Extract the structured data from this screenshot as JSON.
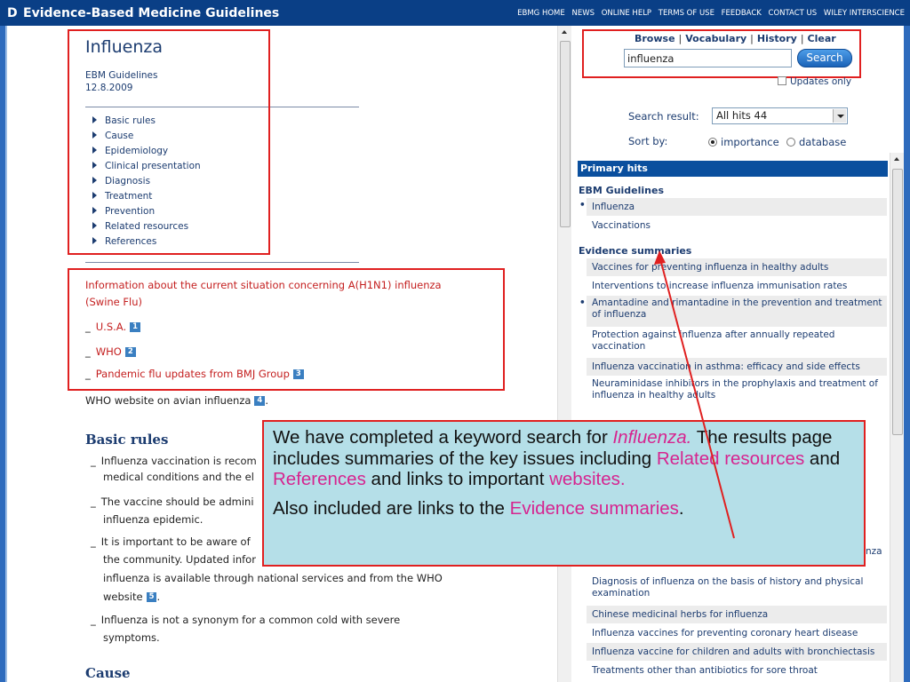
{
  "header": {
    "logo_letter": "D",
    "title": "Evidence-Based Medicine Guidelines",
    "nav": [
      "EBMG HOME",
      "NEWS",
      "ONLINE HELP",
      "TERMS OF USE",
      "FEEDBACK",
      "CONTACT US",
      "WILEY INTERSCIENCE"
    ]
  },
  "article": {
    "title": "Influenza",
    "source": "EBM Guidelines",
    "date": "12.8.2009",
    "toc": [
      "Basic rules",
      "Cause",
      "Epidemiology",
      "Clinical presentation",
      "Diagnosis",
      "Treatment",
      "Prevention",
      "Related resources",
      "References"
    ],
    "h1n1_line1": "Information about the current situation concerning A(H1N1) influenza",
    "h1n1_line2": "(Swine Flu)",
    "links": [
      {
        "text": "U.S.A.",
        "num": "1"
      },
      {
        "text": "WHO",
        "num": "2"
      },
      {
        "text": "Pandemic flu updates from BMJ Group",
        "num": "3"
      }
    ],
    "avian_text": "WHO website on avian influenza",
    "avian_num": "4",
    "avian_end": ".",
    "basic_rules_heading": "Basic rules",
    "basic_rules": [
      "Influenza vaccination is recom",
      "medical conditions and the el",
      "The vaccine should be admini",
      "influenza epidemic.",
      "It is important to be aware of",
      "the community. Updated infor",
      "influenza is available through national services and from the WHO",
      "website",
      "Influenza is not a synonym for a common cold with severe",
      "symptoms."
    ],
    "website_num": "5",
    "website_end": ".",
    "cause_heading": "Cause"
  },
  "search": {
    "tabs": [
      "Browse",
      "Vocabulary",
      "History",
      "Clear"
    ],
    "query": "influenza",
    "button": "Search",
    "updates_only": "Updates only",
    "result_label": "Search result:",
    "result_value": "All hits 44",
    "sort_label": "Sort by:",
    "sort_options": [
      "importance",
      "database"
    ],
    "sort_selected": "importance"
  },
  "results": {
    "primary_hits": "Primary hits",
    "ebm_heading": "EBM Guidelines",
    "ebm_items": [
      "Influenza",
      "Vaccinations"
    ],
    "evidence_heading": "Evidence summaries",
    "evidence_items_top": [
      "Vaccines for preventing influenza in healthy adults",
      "Interventions to increase influenza immunisation rates",
      "Amantadine and rimantadine in the prevention and treatment of influenza",
      "Protection against influenza after annually repeated vaccination",
      "Influenza vaccination in asthma: efficacy and side effects",
      "Neuraminidase inhibitors in the prophylaxis and treatment of influenza in healthy adults"
    ],
    "evidence_fragment": "nza",
    "evidence_items_bottom": [
      "Diagnosis of influenza on the basis of history and physical examination",
      "Chinese medicinal herbs for influenza",
      "Influenza vaccines for preventing coronary heart disease",
      "Influenza vaccine for children and adults with bronchiectasis",
      "Treatments other than antibiotics for sore throat"
    ]
  },
  "callout": {
    "p1_a": "We have completed a keyword search for ",
    "p1_b": "Influenza.",
    "p1_c": "  The results page includes summaries of the key issues including ",
    "p1_d": "Related resources",
    "p1_e": " and ",
    "p1_f": "References",
    "p1_g": " and links to important ",
    "p1_h": "websites.",
    "p2_a": "Also included are links to the ",
    "p2_b": "Evidence summaries",
    "p2_c": "."
  },
  "colors": {
    "header_blue": "#0a3f86",
    "accent_red": "#e02020",
    "link_red": "#c41f1f",
    "highlight_magenta": "#d6248f",
    "callout_bg": "#b5dfe8"
  }
}
